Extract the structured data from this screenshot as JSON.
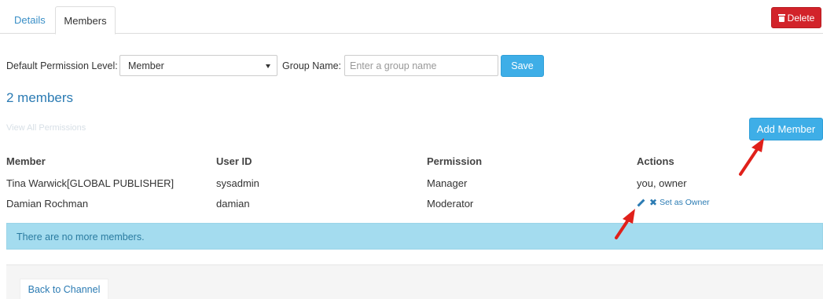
{
  "tabs": [
    {
      "label": "Details",
      "active": false
    },
    {
      "label": "Members",
      "active": true
    }
  ],
  "delete_label": "Delete",
  "form": {
    "permission_label": "Default Permission Level:",
    "permission_value": "Member",
    "group_label": "Group Name:",
    "group_placeholder": "Enter a group name",
    "save_label": "Save"
  },
  "members_count_label": "2 members",
  "view_all_label": "View All Permissions",
  "add_member_label": "Add Member",
  "table": {
    "columns": [
      "Member",
      "User ID",
      "Permission",
      "Actions"
    ],
    "rows": [
      {
        "member": "Tina Warwick[GLOBAL PUBLISHER]",
        "user_id": "sysadmin",
        "permission": "Manager",
        "actions": "you, owner"
      },
      {
        "member": "Damian Rochman",
        "user_id": "damian",
        "permission": "Moderator",
        "actions": "Set as Owner"
      }
    ]
  },
  "info_message": "There are no more members.",
  "back_label": "Back to Channel",
  "colors": {
    "accent": "#3eaee7",
    "link": "#2b7bb3",
    "danger": "#d2232a",
    "info_bg": "#a4dcef",
    "annotation": "#e0201a"
  },
  "icons": [
    "trash-icon",
    "chevron-down-icon",
    "pencil-icon",
    "close-icon",
    "annotation-arrow"
  ]
}
